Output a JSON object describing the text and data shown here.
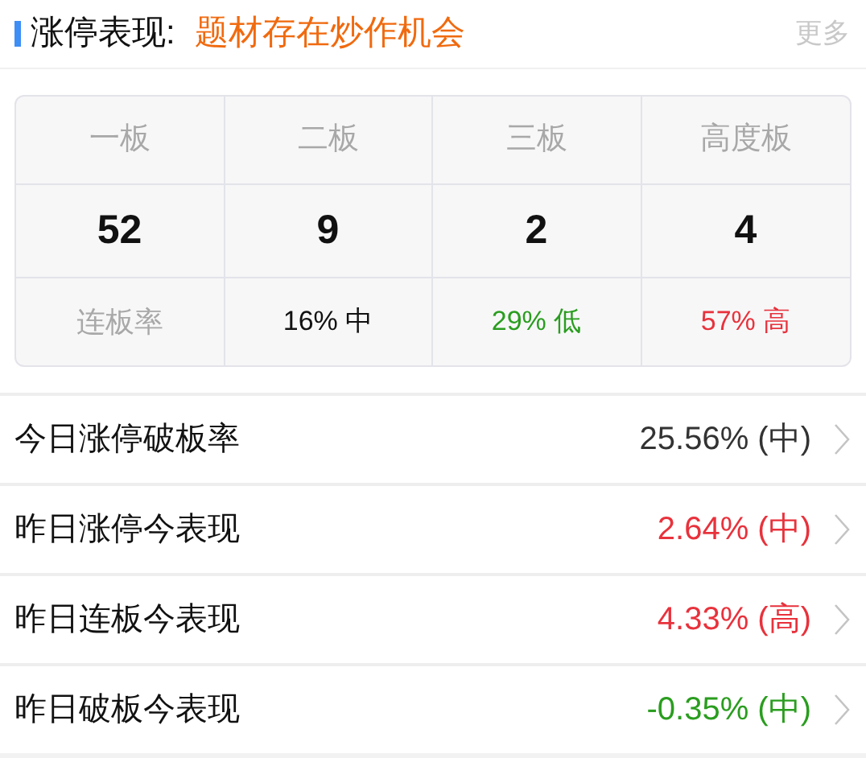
{
  "header": {
    "title": "涨停表现:",
    "subtitle": "题材存在炒作机会",
    "more": "更多"
  },
  "board_table": {
    "columns": [
      "一板",
      "二板",
      "三板",
      "高度板"
    ],
    "counts": [
      "52",
      "9",
      "2",
      "4"
    ],
    "rate_row": {
      "label": "连板率",
      "cells": [
        {
          "text": "16% 中",
          "color": "#111111"
        },
        {
          "text": "29% 低",
          "color": "#2a9d1f"
        },
        {
          "text": "57% 高",
          "color": "#e8323c"
        }
      ]
    }
  },
  "metrics": [
    {
      "label": "今日涨停破板率",
      "value": "25.56% (中)",
      "color": "#333333"
    },
    {
      "label": "昨日涨停今表现",
      "value": "2.64% (中)",
      "color": "#e8323c"
    },
    {
      "label": "昨日连板今表现",
      "value": "4.33% (高)",
      "color": "#e8323c"
    },
    {
      "label": "昨日破板今表现",
      "value": "-0.35% (中)",
      "color": "#2a9d1f"
    }
  ]
}
